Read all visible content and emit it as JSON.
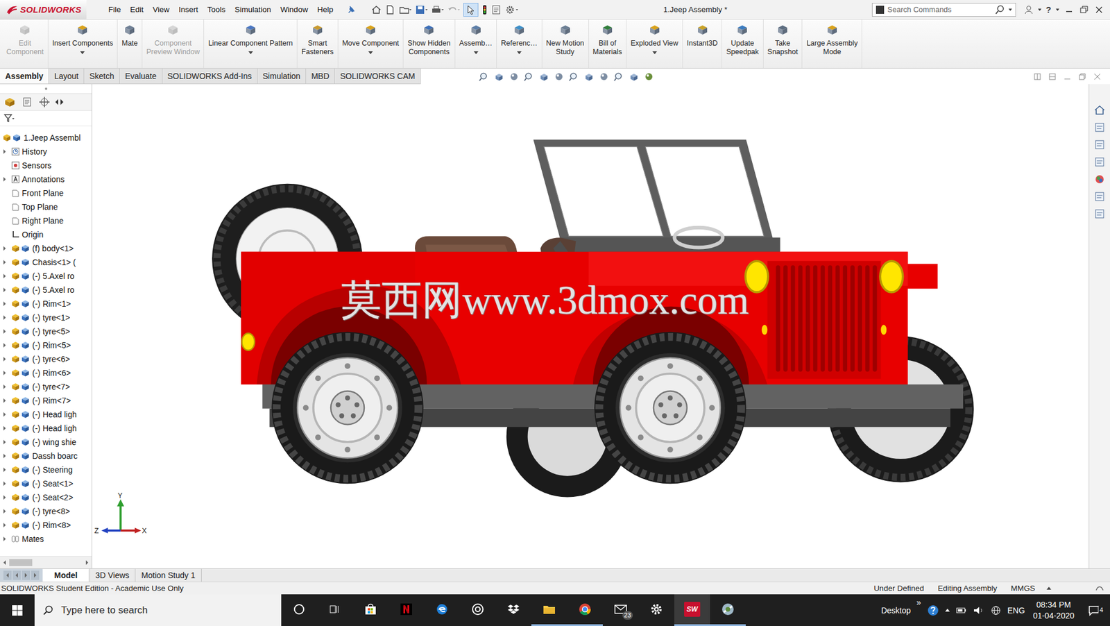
{
  "window": {
    "logo": "SOLIDWORKS",
    "title": "1.Jeep Assembly *",
    "help": "?"
  },
  "menu": [
    "File",
    "Edit",
    "View",
    "Insert",
    "Tools",
    "Simulation",
    "Window",
    "Help"
  ],
  "search": {
    "placeholder": "Search Commands"
  },
  "commands": [
    {
      "lines": [
        "Edit",
        "Component"
      ],
      "disabled": true,
      "dropdown": false
    },
    {
      "lines": [
        "Insert Components"
      ],
      "disabled": false,
      "dropdown": true
    },
    {
      "lines": [
        "Mate"
      ],
      "disabled": false,
      "dropdown": false
    },
    {
      "lines": [
        "Component",
        "Preview Window"
      ],
      "disabled": true,
      "dropdown": false
    },
    {
      "lines": [
        "Linear Component Pattern"
      ],
      "disabled": false,
      "dropdown": true
    },
    {
      "lines": [
        "Smart",
        "Fasteners"
      ],
      "disabled": false,
      "dropdown": false
    },
    {
      "lines": [
        "Move Component"
      ],
      "disabled": false,
      "dropdown": true
    },
    {
      "lines": [
        "Show Hidden",
        "Components"
      ],
      "disabled": false,
      "dropdown": false
    },
    {
      "lines": [
        "Assemb…"
      ],
      "disabled": false,
      "dropdown": true
    },
    {
      "lines": [
        "Referenc…"
      ],
      "disabled": false,
      "dropdown": true
    },
    {
      "lines": [
        "New Motion",
        "Study"
      ],
      "disabled": false,
      "dropdown": false
    },
    {
      "lines": [
        "Bill of",
        "Materials"
      ],
      "disabled": false,
      "dropdown": false
    },
    {
      "lines": [
        "Exploded View"
      ],
      "disabled": false,
      "dropdown": true
    },
    {
      "lines": [
        "Instant3D"
      ],
      "disabled": false,
      "dropdown": false
    },
    {
      "lines": [
        "Update",
        "Speedpak"
      ],
      "disabled": false,
      "dropdown": false
    },
    {
      "lines": [
        "Take",
        "Snapshot"
      ],
      "disabled": false,
      "dropdown": false
    },
    {
      "lines": [
        "Large Assembly",
        "Mode"
      ],
      "disabled": false,
      "dropdown": false
    }
  ],
  "command_tabs": [
    {
      "label": "Assembly",
      "selected": true
    },
    {
      "label": "Layout",
      "selected": false
    },
    {
      "label": "Sketch",
      "selected": false
    },
    {
      "label": "Evaluate",
      "selected": false
    },
    {
      "label": "SOLIDWORKS Add-Ins",
      "selected": false
    },
    {
      "label": "Simulation",
      "selected": false
    },
    {
      "label": "MBD",
      "selected": false
    },
    {
      "label": "SOLIDWORKS CAM",
      "selected": false
    }
  ],
  "tree": {
    "items": [
      {
        "label": "1.Jeep Assembl",
        "kind": "root",
        "expandable": false
      },
      {
        "label": "History",
        "kind": "history",
        "expandable": true
      },
      {
        "label": "Sensors",
        "kind": "sensor",
        "expandable": false
      },
      {
        "label": "Annotations",
        "kind": "annotation",
        "expandable": true
      },
      {
        "label": "Front Plane",
        "kind": "plane",
        "expandable": false
      },
      {
        "label": "Top Plane",
        "kind": "plane",
        "expandable": false
      },
      {
        "label": "Right Plane",
        "kind": "plane",
        "expandable": false
      },
      {
        "label": "Origin",
        "kind": "origin",
        "expandable": false
      },
      {
        "label": "(f) body<1>",
        "kind": "part",
        "expandable": true
      },
      {
        "label": "Chasis<1> (",
        "kind": "part",
        "expandable": true
      },
      {
        "label": "(-) 5.Axel ro",
        "kind": "part",
        "expandable": true
      },
      {
        "label": "(-) 5.Axel ro",
        "kind": "part",
        "expandable": true
      },
      {
        "label": "(-) Rim<1>",
        "kind": "part",
        "expandable": true
      },
      {
        "label": "(-) tyre<1>",
        "kind": "part",
        "expandable": true
      },
      {
        "label": "(-) tyre<5>",
        "kind": "part",
        "expandable": true
      },
      {
        "label": "(-) Rim<5>",
        "kind": "part",
        "expandable": true
      },
      {
        "label": "(-) tyre<6>",
        "kind": "part",
        "expandable": true
      },
      {
        "label": "(-) Rim<6>",
        "kind": "part",
        "expandable": true
      },
      {
        "label": "(-) tyre<7>",
        "kind": "part",
        "expandable": true
      },
      {
        "label": "(-) Rim<7>",
        "kind": "part",
        "expandable": true
      },
      {
        "label": "(-) Head ligh",
        "kind": "part",
        "expandable": true
      },
      {
        "label": "(-) Head ligh",
        "kind": "part",
        "expandable": true
      },
      {
        "label": "(-) wing shie",
        "kind": "part",
        "expandable": true
      },
      {
        "label": "Dassh boarc",
        "kind": "part",
        "expandable": true
      },
      {
        "label": "(-) Steering",
        "kind": "part",
        "expandable": true
      },
      {
        "label": "(-) Seat<1>",
        "kind": "part",
        "expandable": true
      },
      {
        "label": "(-) Seat<2>",
        "kind": "part",
        "expandable": true
      },
      {
        "label": "(-) tyre<8>",
        "kind": "part",
        "expandable": true
      },
      {
        "label": "(-) Rim<8>",
        "kind": "part",
        "expandable": true
      },
      {
        "label": "Mates",
        "kind": "mates",
        "expandable": true
      }
    ]
  },
  "viewport": {
    "watermark": "莫西网www.3dmox.com",
    "axes": {
      "x": "X",
      "y": "Y",
      "z": "Z"
    }
  },
  "model_tabs": [
    {
      "label": "Model",
      "selected": true
    },
    {
      "label": "3D Views",
      "selected": false
    },
    {
      "label": "Motion Study 1",
      "selected": false
    }
  ],
  "status_bar": {
    "left": "SOLIDWORKS Student Edition - Academic Use Only",
    "items": [
      "Under Defined",
      "Editing Assembly",
      "MMGS"
    ]
  },
  "taskbar": {
    "search_placeholder": "Type here to search",
    "apps": [
      {
        "kind": "cortana",
        "running": false,
        "selected": false
      },
      {
        "kind": "taskview",
        "running": false,
        "selected": false
      },
      {
        "kind": "store",
        "running": false,
        "selected": false
      },
      {
        "kind": "netflix",
        "running": false,
        "selected": false
      },
      {
        "kind": "edge",
        "running": false,
        "selected": false
      },
      {
        "kind": "media",
        "running": false,
        "selected": false
      },
      {
        "kind": "dropbox",
        "running": false,
        "selected": false
      },
      {
        "kind": "explorer",
        "running": true,
        "selected": false
      },
      {
        "kind": "chrome",
        "running": true,
        "selected": false
      },
      {
        "kind": "mail",
        "running": false,
        "selected": false,
        "badge": "23"
      },
      {
        "kind": "settings",
        "running": false,
        "selected": false
      },
      {
        "kind": "solidworks",
        "running": true,
        "selected": true,
        "label": "SW"
      },
      {
        "kind": "other",
        "running": true,
        "selected": false
      }
    ],
    "tray": {
      "desktop": "Desktop",
      "more": "»",
      "lang": "ENG",
      "time": "08:34 PM",
      "date": "01-04-2020",
      "notifications": "4"
    }
  }
}
